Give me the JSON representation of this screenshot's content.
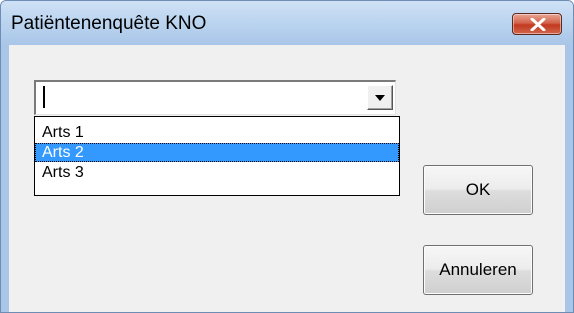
{
  "window": {
    "title": "Patiëntenenquête KNO",
    "close_icon": "close-x-icon"
  },
  "combo": {
    "value": "",
    "dropdown_icon": "chevron-down-icon",
    "options": [
      {
        "label": "Arts 1",
        "selected": false
      },
      {
        "label": "Arts 2",
        "selected": true
      },
      {
        "label": "Arts 3",
        "selected": false
      }
    ]
  },
  "buttons": {
    "ok_label": "OK",
    "cancel_label": "Annuleren"
  },
  "colors": {
    "selection": "#3399ff",
    "titlebar": "#bcd5f0",
    "close_button": "#c2391f"
  }
}
